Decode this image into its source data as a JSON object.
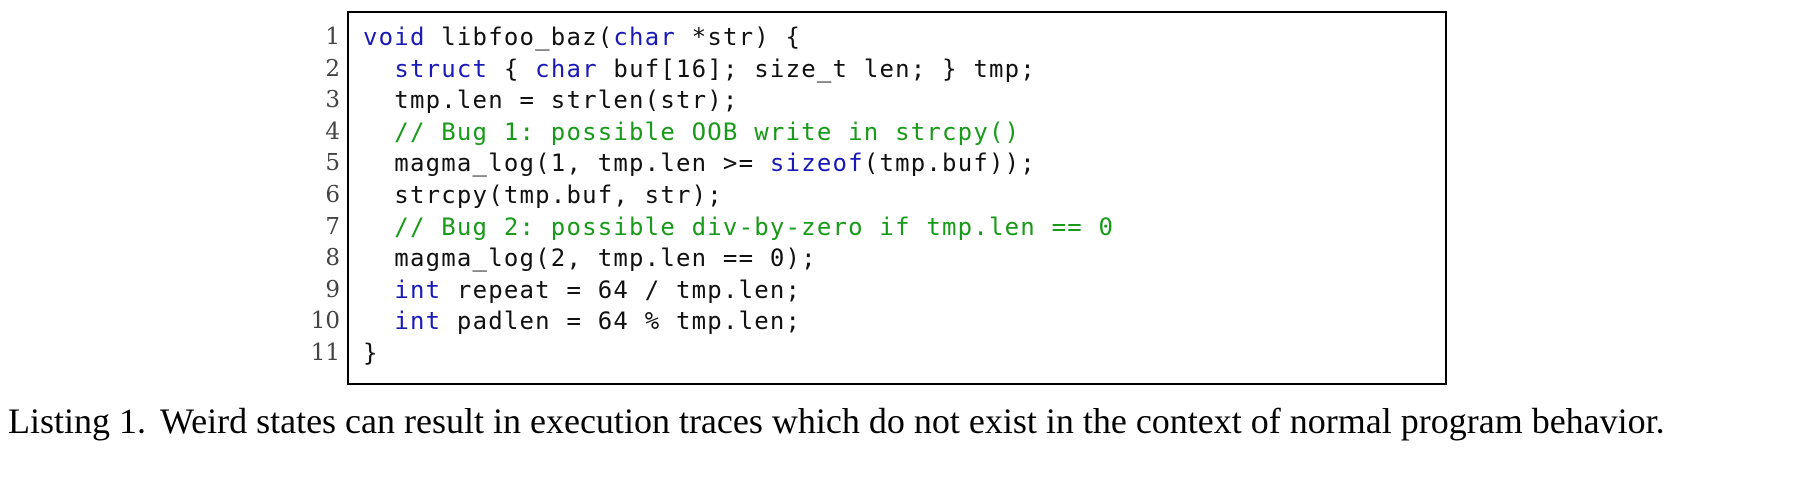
{
  "listing": {
    "line_numbers": [
      "1",
      "2",
      "3",
      "4",
      "5",
      "6",
      "7",
      "8",
      "9",
      "10",
      "11"
    ],
    "lines": [
      [
        {
          "t": "void",
          "k": "kw"
        },
        {
          "t": " libfoo_baz(",
          "k": "tx"
        },
        {
          "t": "char",
          "k": "kw"
        },
        {
          "t": " *str) {",
          "k": "tx"
        }
      ],
      [
        {
          "t": "  ",
          "k": "tx"
        },
        {
          "t": "struct",
          "k": "kw"
        },
        {
          "t": " { ",
          "k": "tx"
        },
        {
          "t": "char",
          "k": "kw"
        },
        {
          "t": " buf[16]; size_t len; } tmp;",
          "k": "tx"
        }
      ],
      [
        {
          "t": "  tmp.len = strlen(str);",
          "k": "tx"
        }
      ],
      [
        {
          "t": "  // Bug 1: possible OOB write in strcpy()",
          "k": "cm"
        }
      ],
      [
        {
          "t": "  magma_log(1, tmp.len >= ",
          "k": "tx"
        },
        {
          "t": "sizeof",
          "k": "kw"
        },
        {
          "t": "(tmp.buf));",
          "k": "tx"
        }
      ],
      [
        {
          "t": "  strcpy(tmp.buf, str);",
          "k": "tx"
        }
      ],
      [
        {
          "t": "  // Bug 2: possible div-by-zero if tmp.len == 0",
          "k": "cm"
        }
      ],
      [
        {
          "t": "  magma_log(2, tmp.len == 0);",
          "k": "tx"
        }
      ],
      [
        {
          "t": "  ",
          "k": "tx"
        },
        {
          "t": "int",
          "k": "kw"
        },
        {
          "t": " repeat = 64 / tmp.len;",
          "k": "tx"
        }
      ],
      [
        {
          "t": "  ",
          "k": "tx"
        },
        {
          "t": "int",
          "k": "kw"
        },
        {
          "t": " padlen = 64 % tmp.len;",
          "k": "tx"
        }
      ],
      [
        {
          "t": "}",
          "k": "tx"
        }
      ]
    ]
  },
  "caption": {
    "label": "Listing 1.",
    "text": "Weird states can result in execution traces which do not exist in the context of normal program behavior."
  },
  "colors": {
    "keyword": "#1a1ab8",
    "comment": "#1a9a1a",
    "text": "#111111"
  }
}
